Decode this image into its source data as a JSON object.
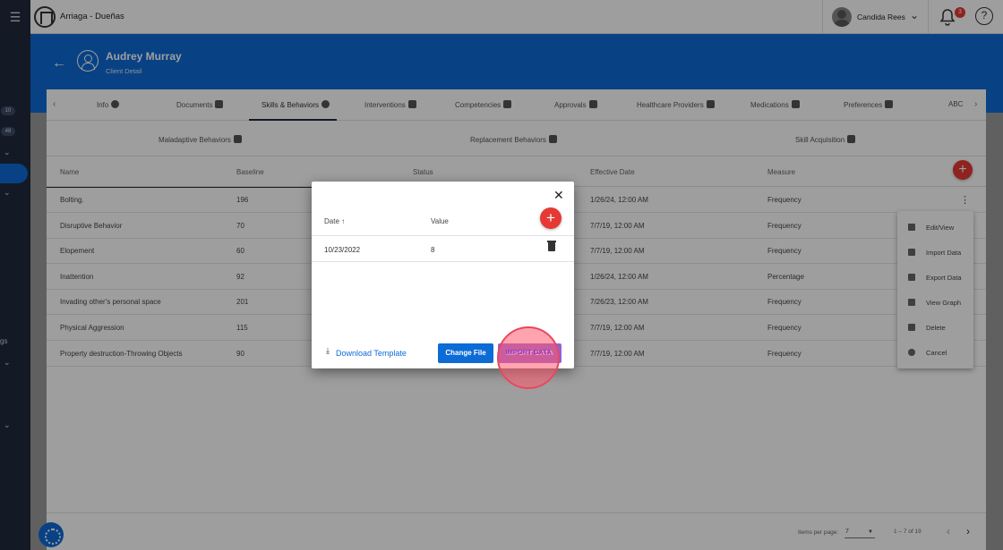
{
  "app": {
    "org_name": "Arriaga - Dueñas",
    "user_name": "Candida Rees",
    "notification_count": "3",
    "help_symbol": "?"
  },
  "sidebar": {
    "badges": [
      "10",
      "48"
    ],
    "partial_text": "gs"
  },
  "client": {
    "name": "Audrey Murray",
    "subtitle": "Client Detail"
  },
  "tabs": [
    {
      "label": "Info",
      "icon": "person-icon"
    },
    {
      "label": "Documents",
      "icon": "document-icon"
    },
    {
      "label": "Skills & Behaviors",
      "icon": "skills-icon"
    },
    {
      "label": "Interventions",
      "icon": "interventions-icon"
    },
    {
      "label": "Competencies",
      "icon": "people-icon"
    },
    {
      "label": "Approvals",
      "icon": "approval-icon"
    },
    {
      "label": "Healthcare Providers",
      "icon": "medical-bag-icon"
    },
    {
      "label": "Medications",
      "icon": "camera-icon"
    },
    {
      "label": "Preferences",
      "icon": "sliders-icon"
    },
    {
      "label": "ABC",
      "icon": "abc-icon"
    }
  ],
  "subtabs": [
    {
      "label": "Maladaptive Behaviors",
      "icon": "thumbs-down-icon"
    },
    {
      "label": "Replacement Behaviors",
      "icon": "thumbs-up-icon"
    },
    {
      "label": "Skill Acquisition",
      "icon": "thumbs-up-icon"
    }
  ],
  "table": {
    "headers": [
      "Name",
      "Baseline",
      "Status",
      "Effective Date",
      "Measure"
    ],
    "rows": [
      {
        "name": "Bolting.",
        "baseline": "196",
        "effective_date": "1/26/24, 12:00 AM",
        "measure": "Frequency"
      },
      {
        "name": "Disruptive Behavior",
        "baseline": "70",
        "effective_date": "7/7/19, 12:00 AM",
        "measure": "Frequency"
      },
      {
        "name": "Elopement",
        "baseline": "60",
        "effective_date": "7/7/19, 12:00 AM",
        "measure": "Frequency"
      },
      {
        "name": "Inattention",
        "baseline": "92",
        "effective_date": "1/26/24, 12:00 AM",
        "measure": "Percentage"
      },
      {
        "name": "Invading other's personal space",
        "baseline": "201",
        "effective_date": "7/26/23, 12:00 AM",
        "measure": "Frequency"
      },
      {
        "name": "Physical Aggression",
        "baseline": "115",
        "effective_date": "7/7/19, 12:00 AM",
        "measure": "Frequency"
      },
      {
        "name": "Property destruction-Throwing Objects",
        "baseline": "90",
        "effective_date": "7/7/19, 12:00 AM",
        "measure": "Frequency"
      }
    ]
  },
  "context_menu": {
    "items": [
      "Edit/View",
      "Import Data",
      "Export Data",
      "View Graph",
      "Delete",
      "Cancel"
    ]
  },
  "pagination": {
    "items_per_page_label": "Items per page:",
    "items_per_page": "7",
    "range": "1 – 7 of 19"
  },
  "modal": {
    "headers": {
      "date": "Date",
      "value": "Value"
    },
    "sort_indicator": "↑",
    "rows": [
      {
        "date": "10/23/2022",
        "value": "8"
      }
    ],
    "download_template": "Download Template",
    "change_file": "Change File",
    "import_data": "IMPORT DATA"
  },
  "colors": {
    "primary": "#0d6bd6",
    "danger": "#e53935",
    "sidebar": "#1f2a3c",
    "import_button": "#8e63d8"
  }
}
